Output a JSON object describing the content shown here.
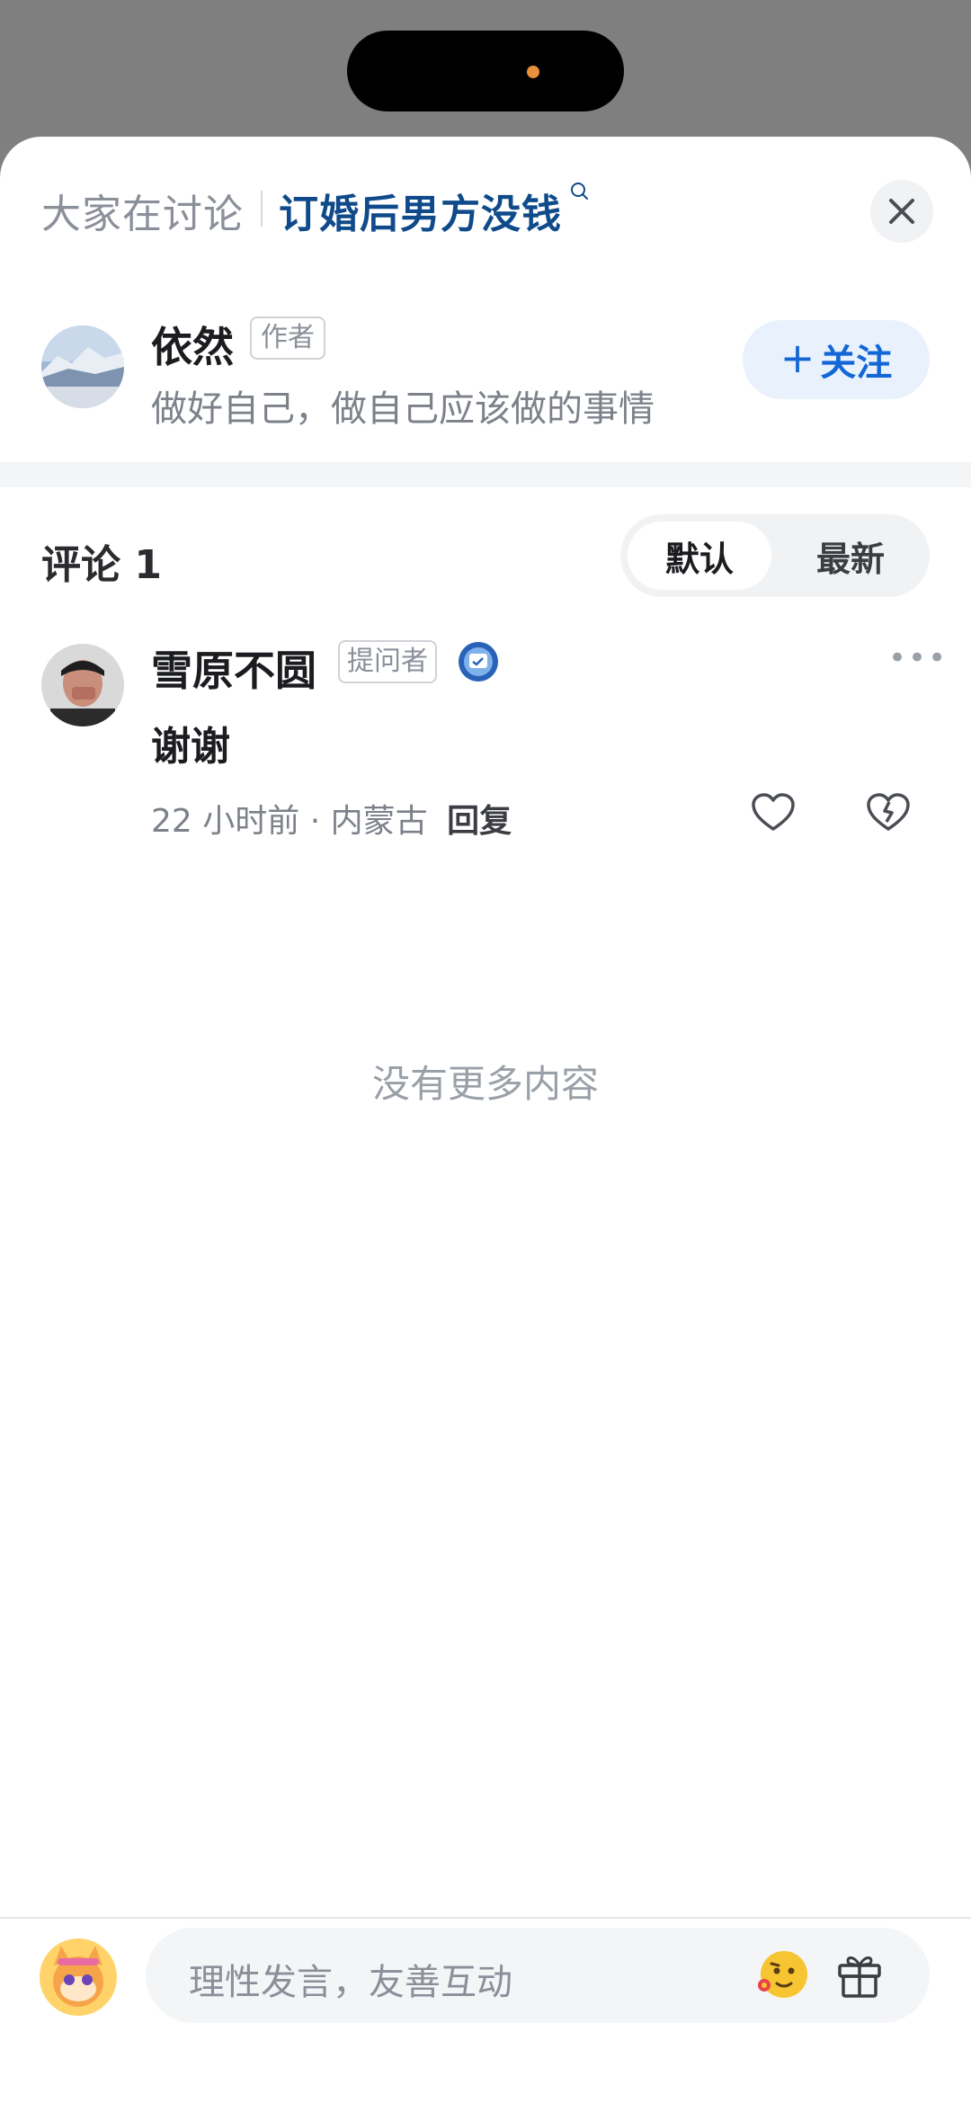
{
  "header": {
    "prefix": "大家在讨论",
    "topic": "订婚后男方没钱"
  },
  "author": {
    "name": "依然",
    "badge": "作者",
    "bio": "做好自己，做自己应该做的事情",
    "follow_label": "关注"
  },
  "comments": {
    "title": "评论 1",
    "sort_options": [
      "默认",
      "最新"
    ],
    "sort_selected": "默认",
    "items": [
      {
        "user": "雪原不圆",
        "badge": "提问者",
        "text": "谢谢",
        "time": "22 小时前",
        "location": "内蒙古",
        "reply_label": "回复"
      }
    ],
    "no_more": "没有更多内容"
  },
  "composer": {
    "placeholder": "理性发言，友善互动"
  },
  "colors": {
    "accent": "#1366d6",
    "topic": "#0f4a8a",
    "island_dot": "#e8913a"
  },
  "icons": [
    "search-icon",
    "close-icon",
    "verified-icon",
    "more-icon",
    "heart-icon",
    "broken-heart-icon",
    "emoji-icon",
    "gift-icon"
  ]
}
